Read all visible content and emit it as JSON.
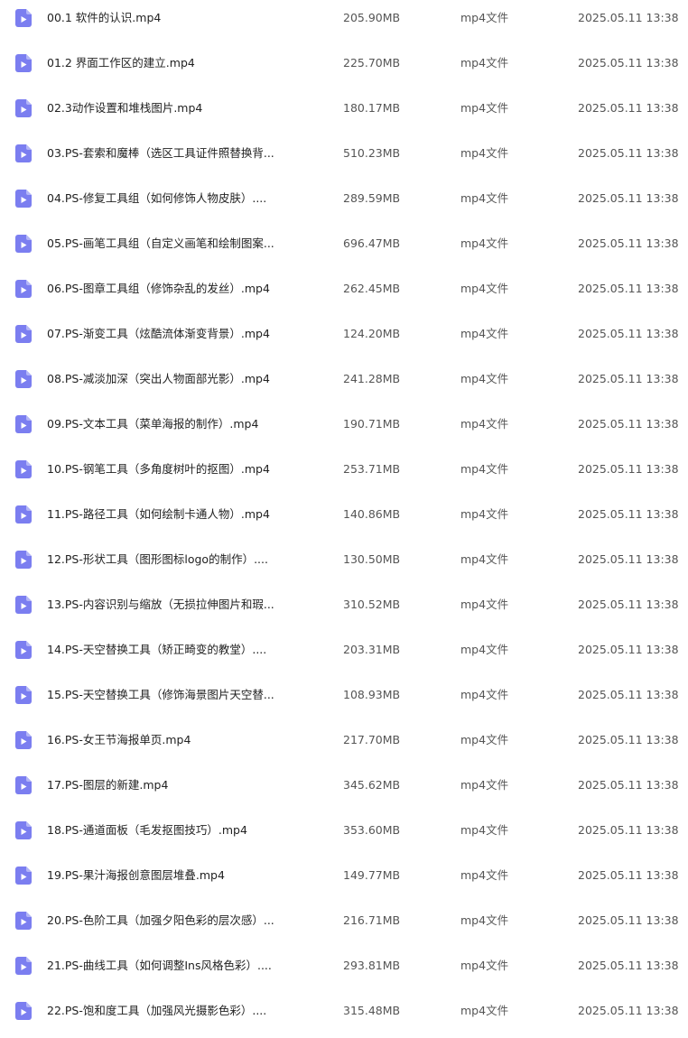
{
  "colors": {
    "icon_fill": "#7b7ef0",
    "icon_fold": "#b3b5f7",
    "icon_play": "#ffffff"
  },
  "files": [
    {
      "name": "00.1 软件的认识.mp4",
      "size": "205.90MB",
      "type": "mp4文件",
      "modified": "2025.05.11 13:38",
      "icon": "video-file-icon"
    },
    {
      "name": "01.2 界面工作区的建立.mp4",
      "size": "225.70MB",
      "type": "mp4文件",
      "modified": "2025.05.11 13:38",
      "icon": "video-file-icon"
    },
    {
      "name": "02.3动作设置和堆栈图片.mp4",
      "size": "180.17MB",
      "type": "mp4文件",
      "modified": "2025.05.11 13:38",
      "icon": "video-file-icon"
    },
    {
      "name": "03.PS-套索和魔棒（选区工具证件照替换背...",
      "size": "510.23MB",
      "type": "mp4文件",
      "modified": "2025.05.11 13:38",
      "icon": "video-file-icon"
    },
    {
      "name": "04.PS-修复工具组（如何修饰人物皮肤）....",
      "size": "289.59MB",
      "type": "mp4文件",
      "modified": "2025.05.11 13:38",
      "icon": "video-file-icon"
    },
    {
      "name": "05.PS-画笔工具组（自定义画笔和绘制图案...",
      "size": "696.47MB",
      "type": "mp4文件",
      "modified": "2025.05.11 13:38",
      "icon": "video-file-icon"
    },
    {
      "name": "06.PS-图章工具组（修饰杂乱的发丝）.mp4",
      "size": "262.45MB",
      "type": "mp4文件",
      "modified": "2025.05.11 13:38",
      "icon": "video-file-icon"
    },
    {
      "name": "07.PS-渐变工具（炫酷流体渐变背景）.mp4",
      "size": "124.20MB",
      "type": "mp4文件",
      "modified": "2025.05.11 13:38",
      "icon": "video-file-icon"
    },
    {
      "name": "08.PS-减淡加深（突出人物面部光影）.mp4",
      "size": "241.28MB",
      "type": "mp4文件",
      "modified": "2025.05.11 13:38",
      "icon": "video-file-icon"
    },
    {
      "name": "09.PS-文本工具（菜单海报的制作）.mp4",
      "size": "190.71MB",
      "type": "mp4文件",
      "modified": "2025.05.11 13:38",
      "icon": "video-file-icon"
    },
    {
      "name": "10.PS-钢笔工具（多角度树叶的抠图）.mp4",
      "size": "253.71MB",
      "type": "mp4文件",
      "modified": "2025.05.11 13:38",
      "icon": "video-file-icon"
    },
    {
      "name": "11.PS-路径工具（如何绘制卡通人物）.mp4",
      "size": "140.86MB",
      "type": "mp4文件",
      "modified": "2025.05.11 13:38",
      "icon": "video-file-icon"
    },
    {
      "name": "12.PS-形状工具（图形图标logo的制作）....",
      "size": "130.50MB",
      "type": "mp4文件",
      "modified": "2025.05.11 13:38",
      "icon": "video-file-icon"
    },
    {
      "name": "13.PS-内容识别与缩放（无损拉伸图片和瑕...",
      "size": "310.52MB",
      "type": "mp4文件",
      "modified": "2025.05.11 13:38",
      "icon": "video-file-icon"
    },
    {
      "name": "14.PS-天空替换工具（矫正畸变的教堂）....",
      "size": "203.31MB",
      "type": "mp4文件",
      "modified": "2025.05.11 13:38",
      "icon": "video-file-icon"
    },
    {
      "name": "15.PS-天空替换工具（修饰海景图片天空替...",
      "size": "108.93MB",
      "type": "mp4文件",
      "modified": "2025.05.11 13:38",
      "icon": "video-file-icon"
    },
    {
      "name": "16.PS-女王节海报单页.mp4",
      "size": "217.70MB",
      "type": "mp4文件",
      "modified": "2025.05.11 13:38",
      "icon": "video-file-icon"
    },
    {
      "name": "17.PS-图层的新建.mp4",
      "size": "345.62MB",
      "type": "mp4文件",
      "modified": "2025.05.11 13:38",
      "icon": "video-file-icon"
    },
    {
      "name": "18.PS-通道面板（毛发抠图技巧）.mp4",
      "size": "353.60MB",
      "type": "mp4文件",
      "modified": "2025.05.11 13:38",
      "icon": "video-file-icon"
    },
    {
      "name": "19.PS-果汁海报创意图层堆叠.mp4",
      "size": "149.77MB",
      "type": "mp4文件",
      "modified": "2025.05.11 13:38",
      "icon": "video-file-icon"
    },
    {
      "name": "20.PS-色阶工具（加强夕阳色彩的层次感）...",
      "size": "216.71MB",
      "type": "mp4文件",
      "modified": "2025.05.11 13:38",
      "icon": "video-file-icon"
    },
    {
      "name": "21.PS-曲线工具（如何调整Ins风格色彩）....",
      "size": "293.81MB",
      "type": "mp4文件",
      "modified": "2025.05.11 13:38",
      "icon": "video-file-icon"
    },
    {
      "name": "22.PS-饱和度工具（加强风光摄影色彩）....",
      "size": "315.48MB",
      "type": "mp4文件",
      "modified": "2025.05.11 13:38",
      "icon": "video-file-icon"
    }
  ]
}
